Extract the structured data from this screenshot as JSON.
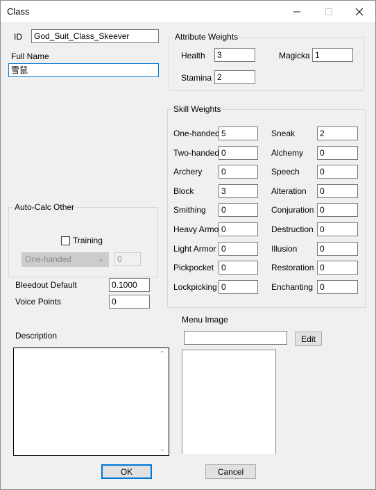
{
  "window": {
    "title": "Class",
    "minimize_icon": "minimize-icon",
    "maximize_icon": "maximize-icon",
    "close_icon": "close-icon"
  },
  "fields": {
    "id_label": "ID",
    "id_value": "God_Suit_Class_Skeever",
    "full_name_label": "Full Name",
    "full_name_value": "雪鼠"
  },
  "attribute_weights": {
    "title": "Attribute Weights",
    "health_label": "Health",
    "health_value": "3",
    "magicka_label": "Magicka",
    "magicka_value": "1",
    "stamina_label": "Stamina",
    "stamina_value": "2"
  },
  "skill_weights": {
    "title": "Skill Weights",
    "left": [
      {
        "label": "One-handed",
        "value": "5"
      },
      {
        "label": "Two-handed",
        "value": "0"
      },
      {
        "label": "Archery",
        "value": "0"
      },
      {
        "label": "Block",
        "value": "3"
      },
      {
        "label": "Smithing",
        "value": "0"
      },
      {
        "label": "Heavy Armor",
        "value": "0"
      },
      {
        "label": "Light Armor",
        "value": "0"
      },
      {
        "label": "Pickpocket",
        "value": "0"
      },
      {
        "label": "Lockpicking",
        "value": "0"
      }
    ],
    "right": [
      {
        "label": "Sneak",
        "value": "2"
      },
      {
        "label": "Alchemy",
        "value": "0"
      },
      {
        "label": "Speech",
        "value": "0"
      },
      {
        "label": "Alteration",
        "value": "0"
      },
      {
        "label": "Conjuration",
        "value": "0"
      },
      {
        "label": "Destruction",
        "value": "0"
      },
      {
        "label": "Illusion",
        "value": "0"
      },
      {
        "label": "Restoration",
        "value": "0"
      },
      {
        "label": "Enchanting",
        "value": "0"
      }
    ]
  },
  "auto_calc": {
    "title": "Auto-Calc Other",
    "training_label": "Training",
    "training_checked": false,
    "skill_select": "One-handed",
    "training_value": "0"
  },
  "misc": {
    "bleedout_label": "Bleedout Default",
    "bleedout_value": "0.1000",
    "voice_points_label": "Voice Points",
    "voice_points_value": "0"
  },
  "description": {
    "label": "Description",
    "value": ""
  },
  "menu_image": {
    "label": "Menu Image",
    "path_value": "",
    "edit_label": "Edit"
  },
  "buttons": {
    "ok": "OK",
    "cancel": "Cancel"
  }
}
